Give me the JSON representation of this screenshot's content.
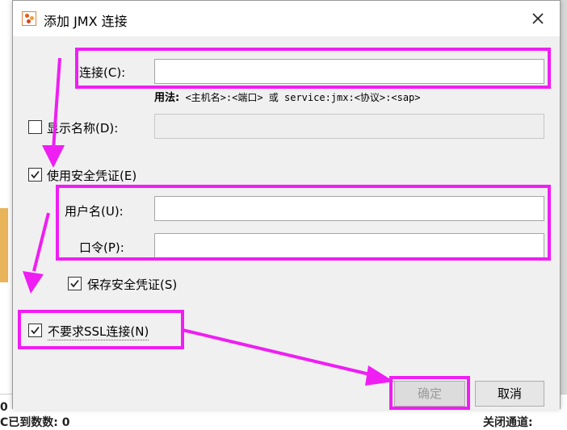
{
  "background": {
    "left_text_1": "0",
    "left_text_2": "C已到数数: 0",
    "right_text": "关闭通道:"
  },
  "dialog": {
    "title": "添加 JMX 连接",
    "icon": "java-console-icon",
    "close_icon": "close-icon",
    "connection": {
      "label": "连接(C):",
      "value": "",
      "usage_prefix": "用法:",
      "usage": "<主机名>:<端口> 或 service:jmx:<协议>:<sap>"
    },
    "show_name": {
      "label": "显示名称(D):",
      "checked": false,
      "value": ""
    },
    "use_credentials": {
      "label": "使用安全凭证(E)",
      "checked": true
    },
    "username": {
      "label": "用户名(U):",
      "value": ""
    },
    "password": {
      "label": "口令(P):",
      "value": ""
    },
    "save_credentials": {
      "label": "保存安全凭证(S)",
      "checked": true
    },
    "no_ssl": {
      "label": "不要求SSL连接(N)",
      "checked": true
    },
    "ok_button": "确定",
    "cancel_button": "取消"
  },
  "colors": {
    "highlight": "#ef1ef3",
    "dialog_bg": "#f0f0f0"
  }
}
